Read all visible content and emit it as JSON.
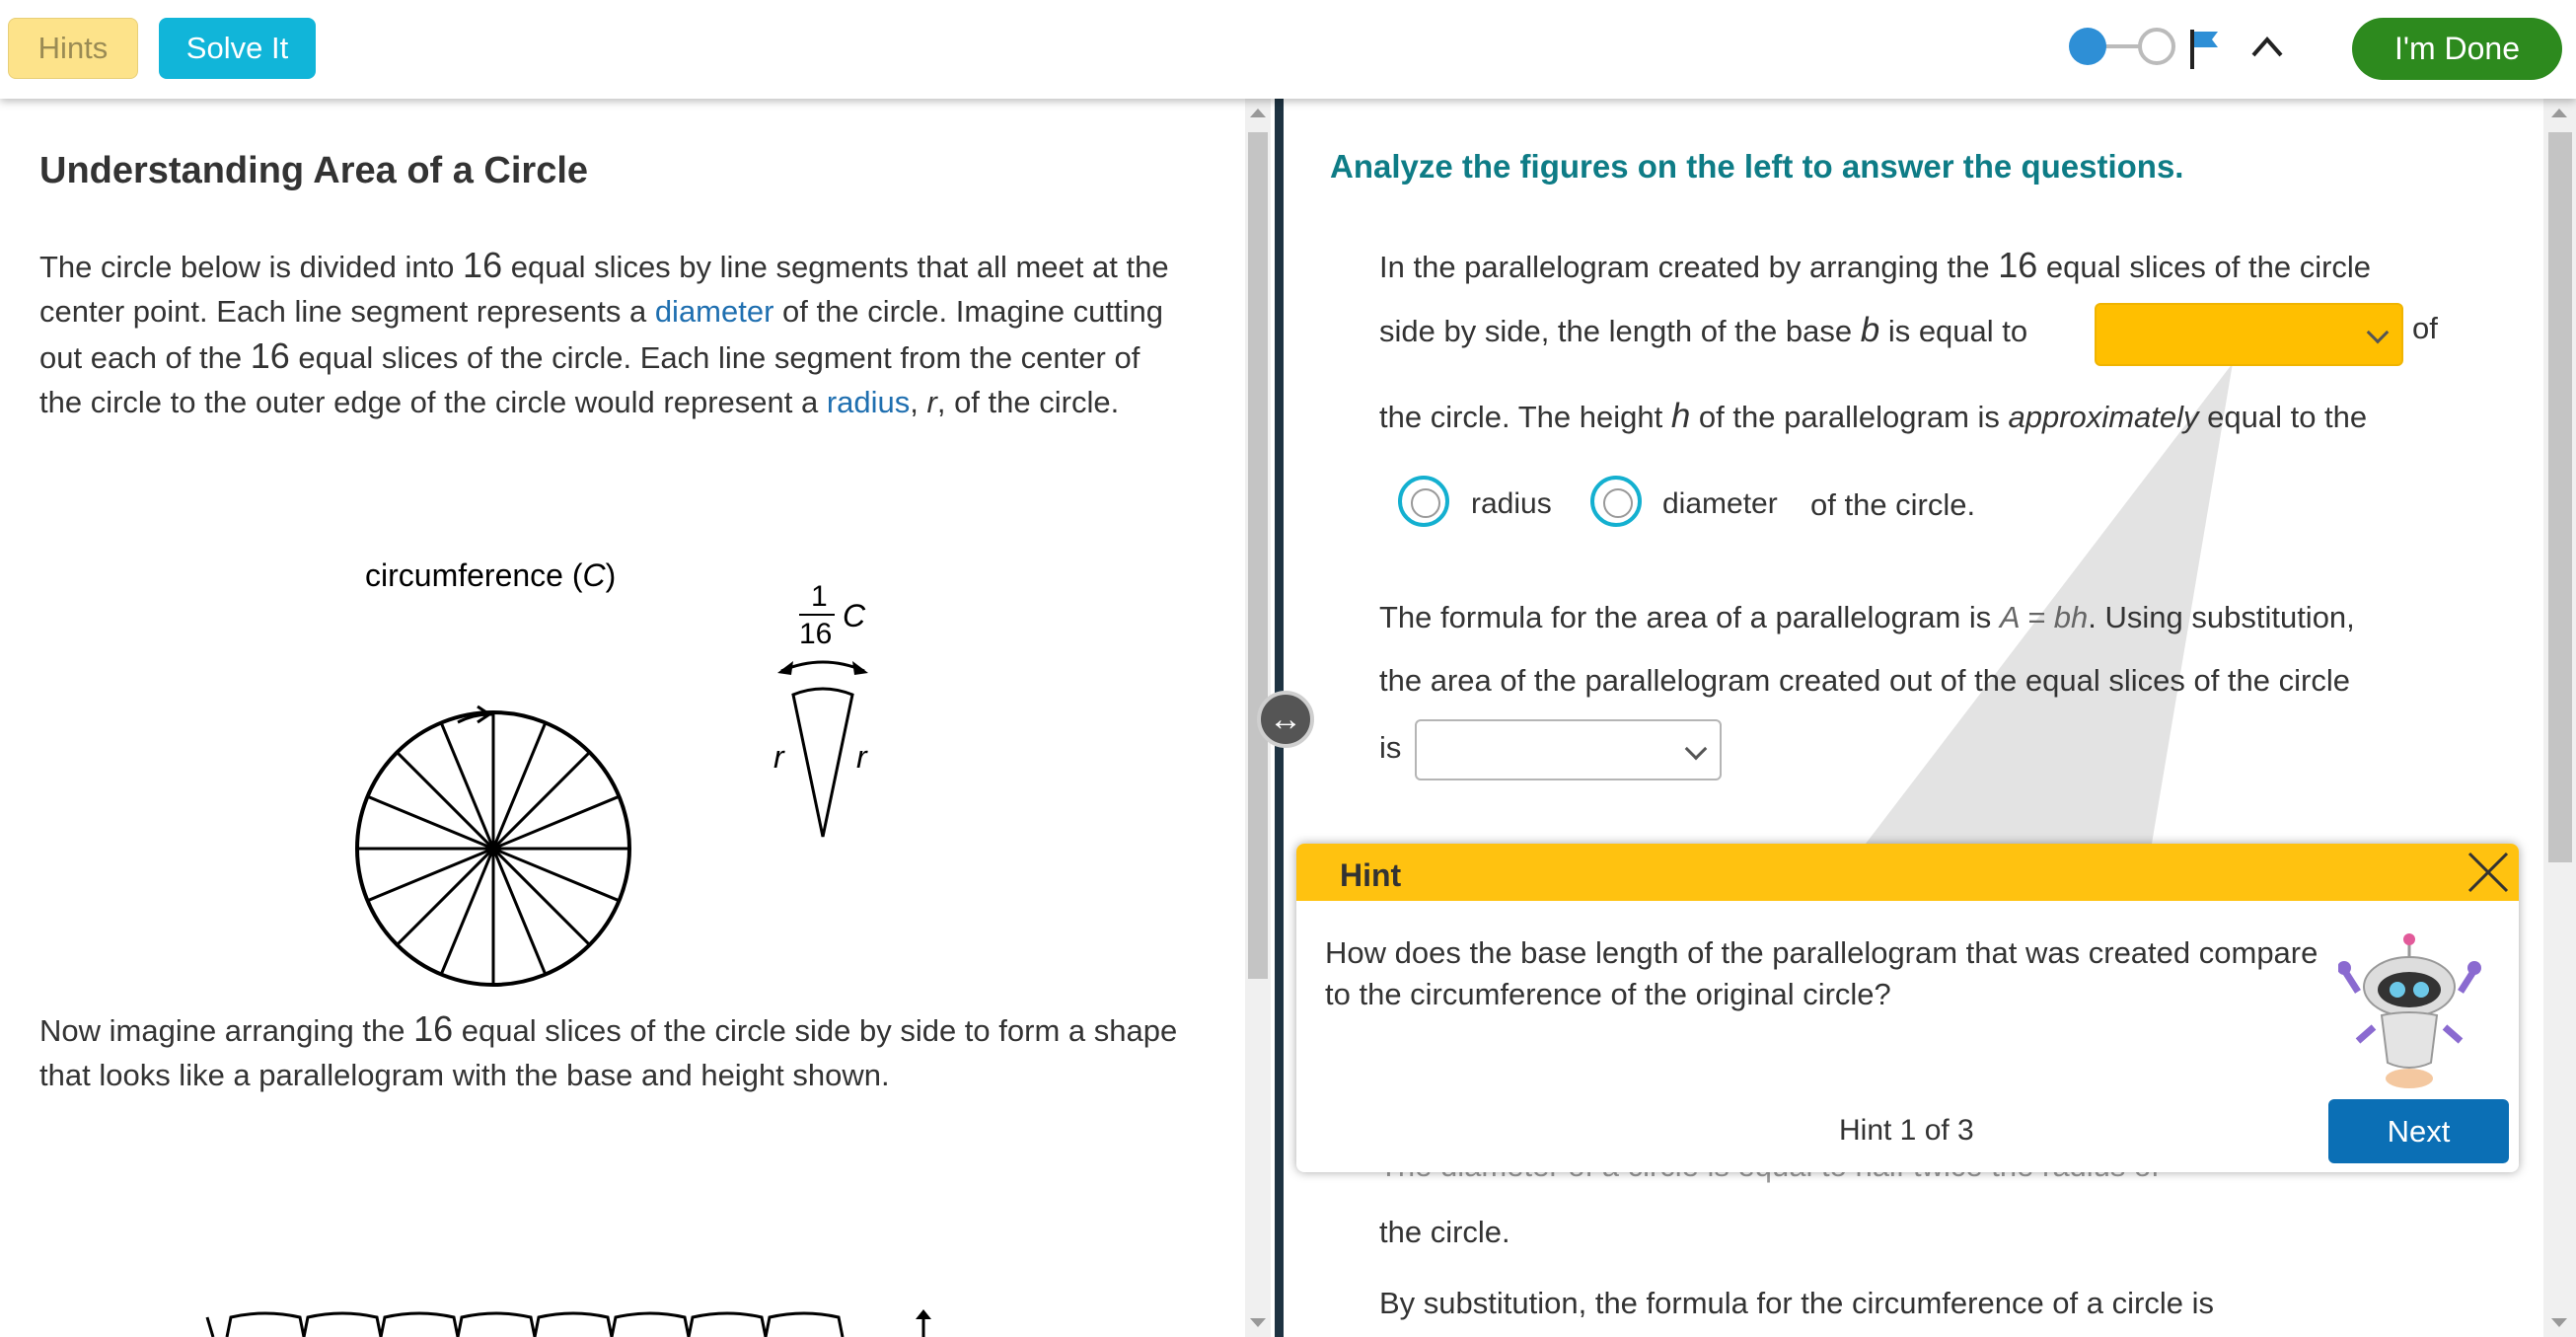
{
  "toolbar": {
    "hints_label": "Hints",
    "solve_label": "Solve It",
    "done_label": "I'm Done"
  },
  "left": {
    "title": "Understanding Area of a Circle",
    "p1": {
      "t1": "The circle below is divided into ",
      "n1": "16",
      "t2": " equal slices by line segments that all meet at the center point. Each line segment represents a ",
      "link1": "diameter",
      "t3": " of the circle. Imagine cutting out each of the ",
      "n2": "16",
      "t4": " equal slices of the circle. Each line segment from the center of the circle to the outer edge of the circle would represent a ",
      "link2": "radius",
      "t5": ", ",
      "var": "r",
      "t6": ", of the circle."
    },
    "figure": {
      "circ_label_prefix": "circumference (",
      "circ_label_var": "C",
      "circ_label_suffix": ")",
      "frac_num": "1",
      "frac_den": "16",
      "frac_var": "C",
      "r_left": "r",
      "r_right": "r"
    },
    "p2": {
      "t1": "Now imagine arranging the ",
      "n1": "16",
      "t2": " equal slices of the circle side by side to form a shape that looks like a parallelogram with the base and height shown."
    }
  },
  "right": {
    "heading": "Analyze the figures on the left to answer the questions.",
    "q1": {
      "l1a": "In the parallelogram created by arranging the ",
      "l1n": "16",
      "l1b": " equal slices of the circle",
      "l2a": "side by side, the length of the base ",
      "l2var": "b",
      "l2b": " is equal to",
      "l2c": "of",
      "l3a": "the circle. The height ",
      "l3var": "h",
      "l3b": " of the parallelogram is ",
      "l3it": "approximately",
      "l3c": " equal to the",
      "opt1": "radius",
      "opt2": "diameter",
      "tail": "of the circle."
    },
    "q2": {
      "l1a": "The formula for the area of a parallelogram is ",
      "formula": "A = bh",
      "l1b": ". Using substitution,",
      "l2": "the area of the parallelogram created out of the equal slices of the circle",
      "l3": "is"
    },
    "q3": {
      "hidden_line": "The diameter of a circle is equal to        half        twice    the radius of",
      "l2": "the circle.",
      "l3": "By substitution, the formula for the circumference of a circle is"
    }
  },
  "hint": {
    "title": "Hint",
    "body": "How does the base length of the parallelogram that was created compare to the circumference of the original circle?",
    "count": "Hint 1 of 3",
    "next_label": "Next"
  },
  "colors": {
    "hint_header": "#ffc210",
    "dropdown_active": "#ffbf00",
    "done_button": "#2d8a1e",
    "solve_button": "#11b5d9",
    "next_button": "#0b6fb5",
    "heading_teal": "#0e7c86"
  }
}
